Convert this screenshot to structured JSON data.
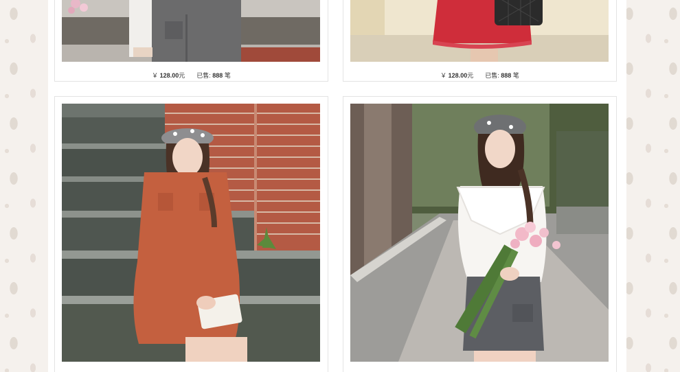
{
  "products": [
    {
      "currency": "￥",
      "price": "128.00",
      "price_unit": "元",
      "sold_label": "已售:",
      "sold_count": "888",
      "sold_unit": "笔",
      "image": "woman-grey-pinafore-dress-photo"
    },
    {
      "currency": "￥",
      "price": "128.00",
      "price_unit": "元",
      "sold_label": "已售:",
      "sold_count": "888",
      "sold_unit": "笔",
      "image": "woman-red-skirt-quilted-bag-photo"
    },
    {
      "image": "woman-orange-shirt-dress-on-steps-photo"
    },
    {
      "image": "woman-white-lace-top-with-flowers-photo"
    }
  ],
  "colors": {
    "page_background": "#f5f1ed",
    "card_border": "#e3e3e3",
    "text": "#333333"
  }
}
